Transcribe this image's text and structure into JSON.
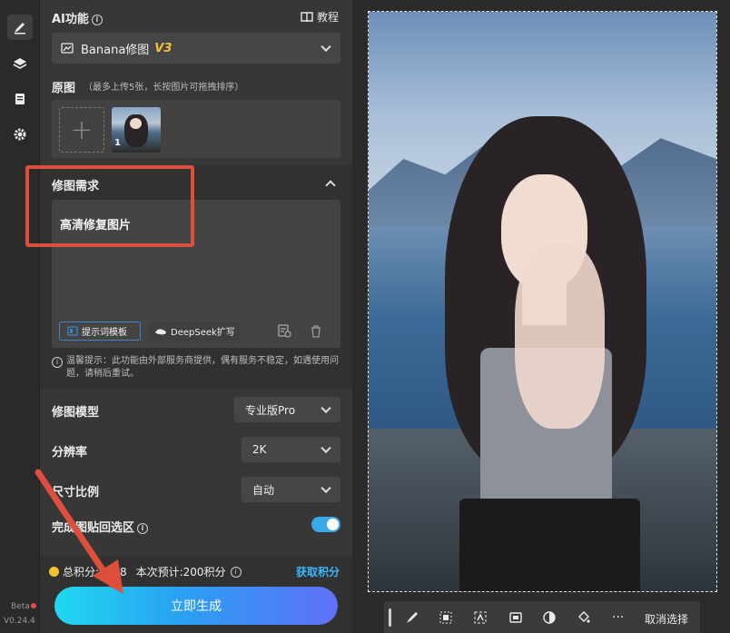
{
  "app": {
    "beta_label": "Beta",
    "version": "V0.24.4"
  },
  "toolbar": {
    "tools": [
      "brush-icon",
      "layers-icon",
      "document-icon",
      "gear-icon"
    ]
  },
  "ai_section": {
    "title": "AI功能",
    "tutorial_label": "教程",
    "function_name": "Banana修图",
    "function_badge": "V3",
    "original_label": "原图",
    "original_hint": "（最多上传5张，长按图片可拖拽排序）",
    "add_symbol": "+",
    "thumbnail_index": "1"
  },
  "requirement": {
    "title": "修图需求",
    "text": "高清修复图片",
    "template_button": "提示词模板",
    "deepseek_button": "DeepSeek扩写",
    "warning": "温馨提示：此功能由外部服务商提供，偶有服务不稳定，如遇使用问题，请稍后重试。"
  },
  "options": {
    "model_label": "修图模型",
    "model_value": "专业版Pro",
    "resolution_label": "分辨率",
    "resolution_value": "2K",
    "ratio_label": "尺寸比例",
    "ratio_value": "自动",
    "paste_back_label": "完成图贴回选区",
    "paste_back_on": true
  },
  "footer": {
    "points_text": "总积分:9028",
    "estimate_text": "本次预计:200积分",
    "get_points": "获取积分",
    "generate_button": "立即生成"
  },
  "canvas_toolbar": {
    "cancel_selection": "取消选择",
    "more": "···"
  },
  "colors": {
    "accent_blue": "#3aa9e8",
    "annotation_red": "#dd4e3b",
    "badge_gold": "#f4c23a"
  }
}
